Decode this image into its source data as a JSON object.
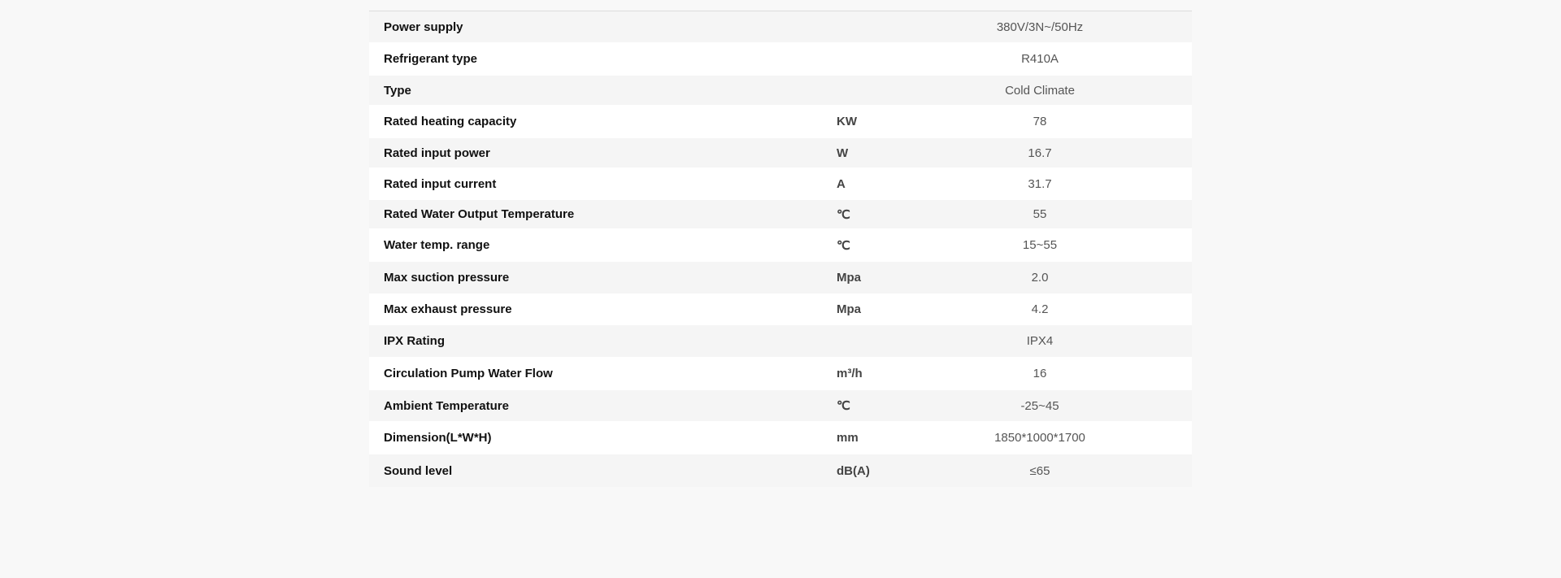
{
  "spec_table": {
    "rows": [
      {
        "parameter": "Power supply",
        "unit": "",
        "value": "380V/3N~/50Hz"
      },
      {
        "parameter": "Refrigerant type",
        "unit": "",
        "value": "R410A"
      },
      {
        "parameter": "Type",
        "unit": "",
        "value": "Cold Climate"
      },
      {
        "parameter": "Rated heating capacity",
        "unit": "KW",
        "value": "78"
      },
      {
        "parameter": "Rated input power",
        "unit": "W",
        "value": "16.7"
      },
      {
        "parameter": "Rated input current",
        "unit": "A",
        "value": "31.7"
      },
      {
        "parameter": "Rated Water Output Temperature",
        "unit": "℃",
        "value": "55"
      },
      {
        "parameter": "Water temp. range",
        "unit": "℃",
        "value": "15~55"
      },
      {
        "parameter": "Max suction pressure",
        "unit": "Mpa",
        "value": "2.0"
      },
      {
        "parameter": "Max exhaust pressure",
        "unit": "Mpa",
        "value": "4.2"
      },
      {
        "parameter": "IPX Rating",
        "unit": "",
        "value": "IPX4"
      },
      {
        "parameter": "Circulation Pump Water Flow",
        "unit": "m³/h",
        "value": "16"
      },
      {
        "parameter": "Ambient Temperature",
        "unit": "℃",
        "value": "-25~45"
      },
      {
        "parameter": "Dimension(L*W*H)",
        "unit": "mm",
        "value": "1850*1000*1700"
      },
      {
        "parameter": "Sound level",
        "unit": "dB(A)",
        "value": "≤65"
      }
    ]
  }
}
